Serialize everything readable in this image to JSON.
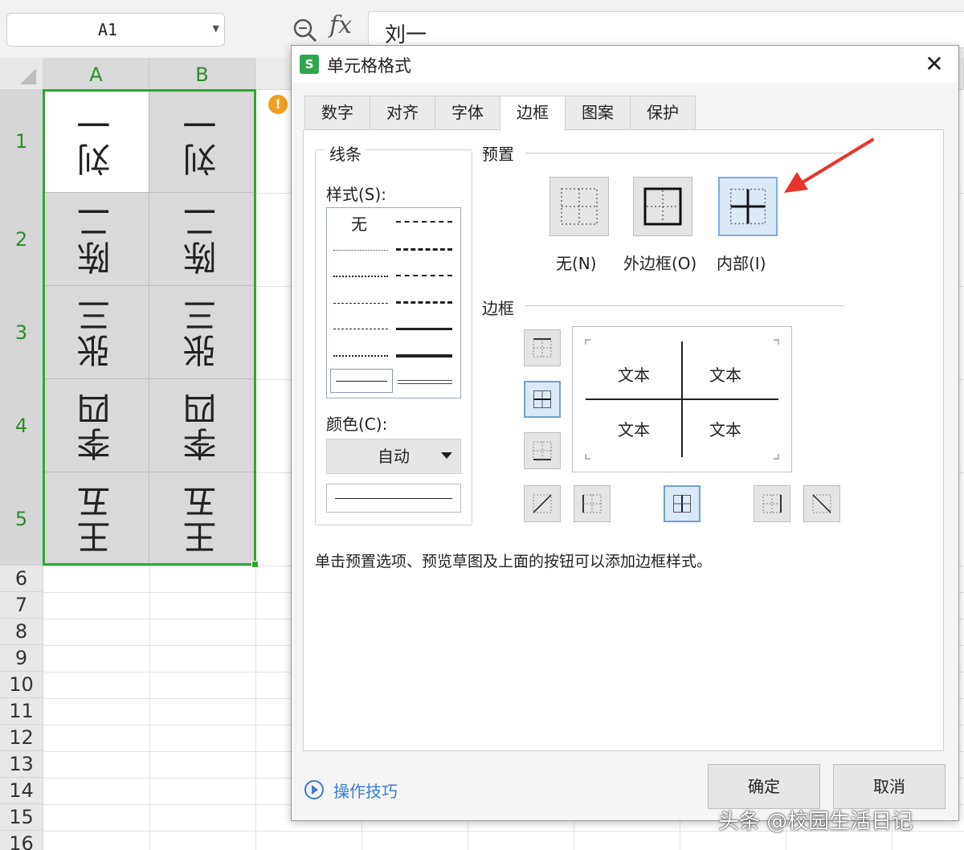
{
  "formula_bar": {
    "cell_ref": "A1",
    "fx_label": "fx",
    "content": "刘一"
  },
  "sheet": {
    "columns": [
      "A",
      "B"
    ],
    "rows": [
      "1",
      "2",
      "3",
      "4",
      "5",
      "6",
      "7",
      "8",
      "9",
      "10",
      "11",
      "12",
      "13",
      "14",
      "15",
      "16"
    ],
    "cells": [
      [
        "刘一",
        "刘一"
      ],
      [
        "陈二",
        "陈二"
      ],
      [
        "张三",
        "张三"
      ],
      [
        "李四",
        "李四"
      ],
      [
        "王五",
        "王五"
      ]
    ]
  },
  "dialog": {
    "title": "单元格格式",
    "tabs": [
      "数字",
      "对齐",
      "字体",
      "边框",
      "图案",
      "保护"
    ],
    "active_tab": "边框",
    "line_group": {
      "title": "线条",
      "style_label": "样式(S):",
      "none_label": "无",
      "color_label": "颜色(C):",
      "color_value": "自动"
    },
    "preset_group": {
      "title": "预置",
      "none": "无(N)",
      "outline": "外边框(O)",
      "inside": "内部(I)"
    },
    "border_group": {
      "title": "边框",
      "preview_text": [
        "文本",
        "文本",
        "文本",
        "文本"
      ]
    },
    "hint": "单击预置选项、预览草图及上面的按钮可以添加边框样式。",
    "tips_link": "操作技巧",
    "ok": "确定",
    "cancel": "取消"
  },
  "watermark": "头条 @校园生活日记",
  "colors": {
    "selection": "#2fa82f",
    "accent": "#3a7bd5",
    "arrow": "#e8352b",
    "logo": "#2ea64f"
  }
}
